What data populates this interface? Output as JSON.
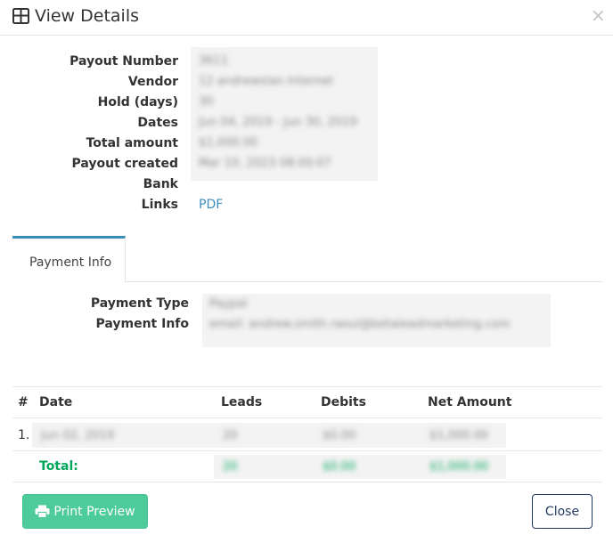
{
  "header": {
    "title": "View Details",
    "title_icon": "grid-icon",
    "close_glyph": "×"
  },
  "details": {
    "rows": [
      {
        "label": "Payout Number",
        "value": "3611"
      },
      {
        "label": "Vendor",
        "value": "12 andrewslan Internet"
      },
      {
        "label": "Hold (days)",
        "value": "30"
      },
      {
        "label": "Dates",
        "value": "Jun 04, 2019 - Jun 30, 2019"
      },
      {
        "label": "Total amount",
        "value": "$1,000.00"
      },
      {
        "label": "Payout created",
        "value": "Mar 10, 2023 08:00:07"
      },
      {
        "label": "Bank",
        "value": ""
      },
      {
        "label": "Links",
        "value": "PDF"
      }
    ]
  },
  "tabs": [
    {
      "label": "Payment Info",
      "active": true
    }
  ],
  "payment": {
    "type_label": "Payment Type",
    "type_value": "Paypal",
    "info_label": "Payment Info",
    "info_value": "email: andrew.smith.raoul@betaleadmarketing.com"
  },
  "table": {
    "headers": [
      "#",
      "Date",
      "Leads",
      "Debits",
      "Net Amount"
    ],
    "rows": [
      {
        "num": "1.",
        "date": "Jun 02, 2019",
        "leads": "20",
        "debits": "$0.00",
        "net": "$1,000.00"
      }
    ],
    "total": {
      "label": "Total:",
      "leads": "20",
      "debits": "$0.00",
      "net": "$1,000.00"
    }
  },
  "footer": {
    "print_label": "Print Preview",
    "print_icon": "printer-icon",
    "close_label": "Close"
  },
  "colors": {
    "link": "#3c8dbc",
    "success": "#00a65a",
    "print_button": "#4ecb9a",
    "close_border": "#1f3a5f"
  }
}
